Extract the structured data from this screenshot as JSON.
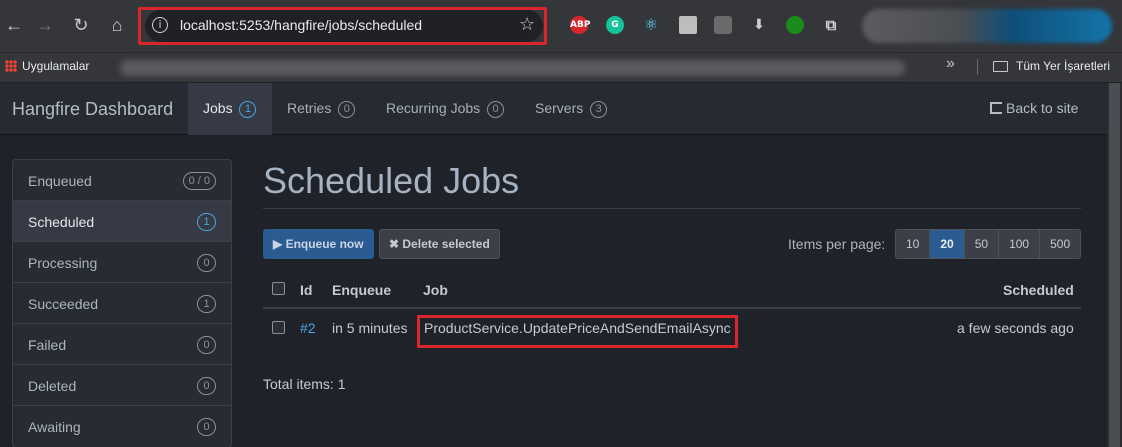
{
  "browser": {
    "url": "localhost:5253/hangfire/jobs/scheduled",
    "extensions": [
      {
        "label": "ABP",
        "color": "#d9262c"
      },
      {
        "label": "G",
        "color": "#15c39a"
      },
      {
        "label": "⚛",
        "color": "#2b2b2b"
      },
      {
        "label": "",
        "color": "#bdbdbd"
      },
      {
        "label": "",
        "color": "#6b6b6b"
      },
      {
        "label": "⬇",
        "color": "#35363a"
      },
      {
        "label": "",
        "color": "#1b8c1b"
      }
    ],
    "bookmarks": {
      "apps_label": "Uygulamalar",
      "all_bookmarks_label": "Tüm Yer İşaretleri"
    }
  },
  "hangfire": {
    "brand": "Hangfire Dashboard",
    "nav": [
      {
        "label": "Jobs",
        "count": "1",
        "active": true
      },
      {
        "label": "Retries",
        "count": "0"
      },
      {
        "label": "Recurring Jobs",
        "count": "0"
      },
      {
        "label": "Servers",
        "count": "3"
      }
    ],
    "back_to_site": "Back to site",
    "sidebar": [
      {
        "label": "Enqueued",
        "count": "0 / 0"
      },
      {
        "label": "Scheduled",
        "count": "1",
        "active": true
      },
      {
        "label": "Processing",
        "count": "0"
      },
      {
        "label": "Succeeded",
        "count": "1"
      },
      {
        "label": "Failed",
        "count": "0"
      },
      {
        "label": "Deleted",
        "count": "0"
      },
      {
        "label": "Awaiting",
        "count": "0"
      }
    ],
    "page_title": "Scheduled Jobs",
    "actions": {
      "enqueue_now": "▶ Enqueue now",
      "delete_selected": "✖ Delete selected"
    },
    "items_per_page": {
      "label": "Items per page:",
      "options": [
        "10",
        "20",
        "50",
        "100",
        "500"
      ],
      "selected": "20"
    },
    "table": {
      "headers": {
        "id": "Id",
        "enqueue": "Enqueue",
        "job": "Job",
        "scheduled": "Scheduled"
      },
      "rows": [
        {
          "id": "#2",
          "enqueue": "in 5 minutes",
          "job": "ProductService.UpdatePriceAndSendEmailAsync",
          "scheduled": "a few seconds ago"
        }
      ]
    },
    "total_items": "Total items: 1"
  }
}
